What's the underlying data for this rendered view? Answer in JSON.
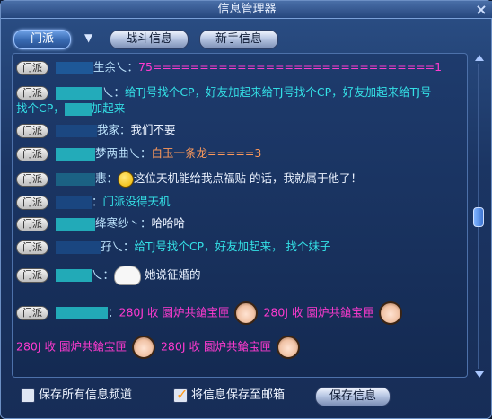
{
  "window": {
    "title": "信息管理器",
    "close_icon": "×"
  },
  "tabs": {
    "active": "门派",
    "dropdown_icon": "▼",
    "items": [
      "战斗信息",
      "新手信息"
    ]
  },
  "chat": {
    "badge": "门派",
    "lines": [
      {
        "name_suffix": "生余乀：",
        "message": "75==============================1",
        "color": "#ff3ad0"
      },
      {
        "name_suffix": "乀：",
        "message": "给TJ号找个CP，好友加起来给TJ号找个CP，好友加起来给TJ号",
        "color": "#34e0e6"
      },
      {
        "continuation": "找个CP，",
        "continuation_tail": "加起来"
      },
      {
        "name_suffix": "我家：",
        "message": "我们不要",
        "color": "#eaf2ff"
      },
      {
        "name_suffix": "梦两曲乀：",
        "message": "白玉一条龙=====3",
        "color": "#ff9a5a"
      },
      {
        "name_suffix": "悲：",
        "message": "这位天机能给我点福贴 的话，我就属于他了！",
        "color": "#eaf2ff",
        "emoji": "smiley"
      },
      {
        "name_suffix": "：",
        "message": "门派没得天机",
        "color": "#34e0e6"
      },
      {
        "name_suffix": "绛寒纱丶：",
        "message": "哈哈哈",
        "color": "#eaf2ff"
      },
      {
        "name_suffix": "孖乀：",
        "message": "给TJ号找个CP，好友加起来， 找个妹子",
        "color": "#34e0e6"
      },
      {
        "name_suffix": "乀：",
        "message": "她说征婚的",
        "color": "#eaf2ff",
        "emoji": "ghost"
      },
      {
        "name_suffix": "：",
        "message": "280J 收 圜炉共鎗宝匣",
        "color": "#ff3ad0",
        "repeat_first_row": 2
      },
      {
        "continuation": "280J 收 圜炉共鎗宝匣",
        "repeat": 2,
        "color": "#ff3ad0"
      }
    ]
  },
  "footer": {
    "save_all_label": "保存所有信息频道",
    "save_all_checked": false,
    "save_mail_label": "将信息保存至邮箱",
    "save_mail_checked": true,
    "save_button_label": "保存信息"
  }
}
